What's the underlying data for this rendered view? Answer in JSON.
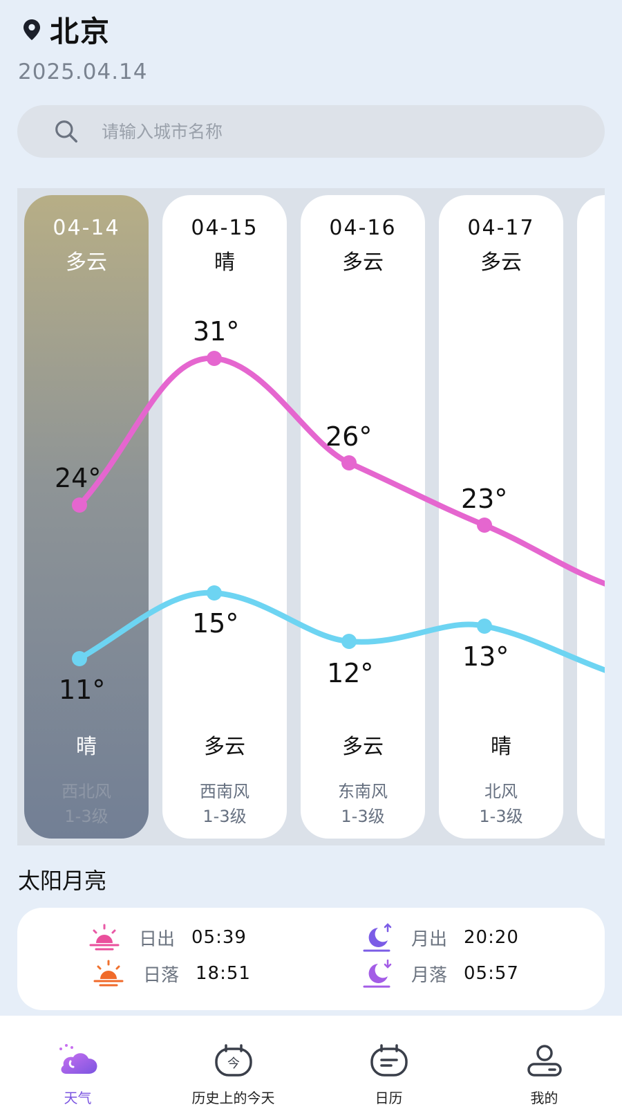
{
  "header": {
    "city": "北京",
    "date": "2025.04.14",
    "pin_icon": "location-pin-icon"
  },
  "search": {
    "placeholder": "请输入城市名称",
    "value": ""
  },
  "forecast": {
    "days": [
      {
        "date": "04-14",
        "day_weather": "多云",
        "high": "24°",
        "low": "11°",
        "night_weather": "晴",
        "wind": "西北风",
        "level": "1-3级",
        "selected": true
      },
      {
        "date": "04-15",
        "day_weather": "晴",
        "high": "31°",
        "low": "15°",
        "night_weather": "多云",
        "wind": "西南风",
        "level": "1-3级"
      },
      {
        "date": "04-16",
        "day_weather": "多云",
        "high": "26°",
        "low": "12°",
        "night_weather": "多云",
        "wind": "东南风",
        "level": "1-3级"
      },
      {
        "date": "04-17",
        "day_weather": "多云",
        "high": "23°",
        "low": "13°",
        "night_weather": "晴",
        "wind": "北风",
        "level": "1-3级"
      }
    ],
    "colors": {
      "high_line": "#e566cf",
      "low_line": "#6dd4f2",
      "today_top": "#b7ae86",
      "today_bottom": "#727f95"
    }
  },
  "sun_moon": {
    "title": "太阳月亮",
    "sunrise": {
      "label": "日出",
      "time": "05:39",
      "icon": "sunrise-icon"
    },
    "sunset": {
      "label": "日落",
      "time": "18:51",
      "icon": "sunset-icon"
    },
    "moonrise": {
      "label": "月出",
      "time": "20:20",
      "icon": "moonrise-icon"
    },
    "moonset": {
      "label": "月落",
      "time": "05:57",
      "icon": "moonset-icon"
    }
  },
  "nav": {
    "items": [
      {
        "label": "天气",
        "icon": "weather-cloud-icon",
        "active": true
      },
      {
        "label": "历史上的今天",
        "icon": "history-today-icon"
      },
      {
        "label": "日历",
        "icon": "calendar-icon"
      },
      {
        "label": "我的",
        "icon": "profile-icon"
      }
    ],
    "active_color": "#7b55e0"
  }
}
